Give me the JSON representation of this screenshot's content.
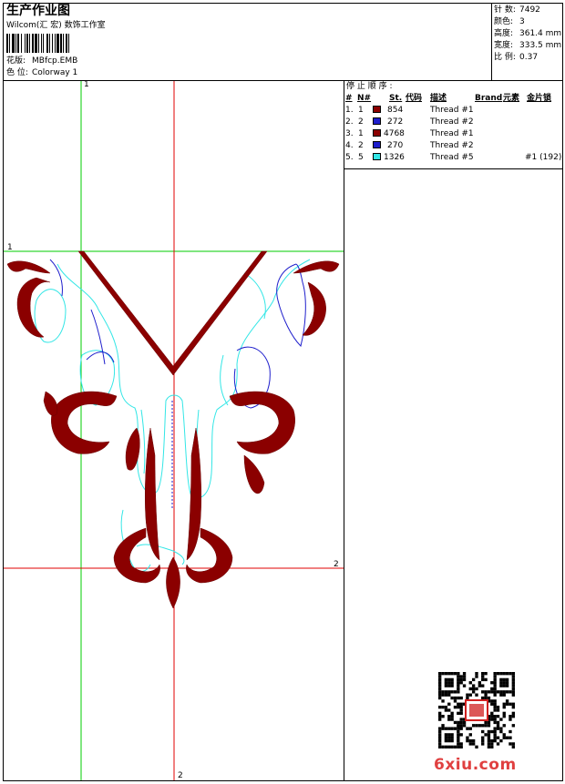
{
  "header": {
    "title": "生产作业图",
    "subtitle": "Wilcom(汇 宏) 数饰工作室",
    "design_label": "花版:",
    "design_value": "MBfcp.EMB",
    "colorway_label": "色 位:",
    "colorway_value": "Colorway 1"
  },
  "stats": [
    {
      "label": "针 数:",
      "value": "7492"
    },
    {
      "label": "颜色:",
      "value": "3"
    },
    {
      "label": "高度:",
      "value": "361.4 mm"
    },
    {
      "label": "宽度:",
      "value": "333.5 mm"
    },
    {
      "label": "比 例:",
      "value": "0.37"
    }
  ],
  "stop_sequence": {
    "title": "停 止 顺 序 :",
    "columns": [
      "#",
      "N#",
      "St.",
      "代码",
      "描述",
      "Brand",
      "元素",
      "金片锁"
    ],
    "rows": [
      {
        "idx": "1.",
        "n": "1",
        "color": "#8b0000",
        "st": "854",
        "desc": "Thread #1",
        "extra": ""
      },
      {
        "idx": "2.",
        "n": "2",
        "color": "#1e1ecc",
        "st": "272",
        "desc": "Thread #2",
        "extra": ""
      },
      {
        "idx": "3.",
        "n": "1",
        "color": "#8b0000",
        "st": "4768",
        "desc": "Thread #1",
        "extra": ""
      },
      {
        "idx": "4.",
        "n": "2",
        "color": "#1e1ecc",
        "st": "270",
        "desc": "Thread #2",
        "extra": ""
      },
      {
        "idx": "5.",
        "n": "5",
        "color": "#33e6e6",
        "st": "1326",
        "desc": "Thread #5",
        "extra": "#1 (192)"
      }
    ]
  },
  "axes": {
    "v_green_top": "1",
    "h_green_left": "1",
    "h_red_right": "2",
    "v_red_bottom": "2"
  },
  "watermark": {
    "text": "6xiu.com"
  },
  "colors": {
    "thread1": "#8b0000",
    "thread2": "#1e1ecc",
    "thread5": "#33e6e6",
    "green_axis": "#00cc00",
    "red_axis": "#e00000",
    "watermark": "#e04040"
  }
}
